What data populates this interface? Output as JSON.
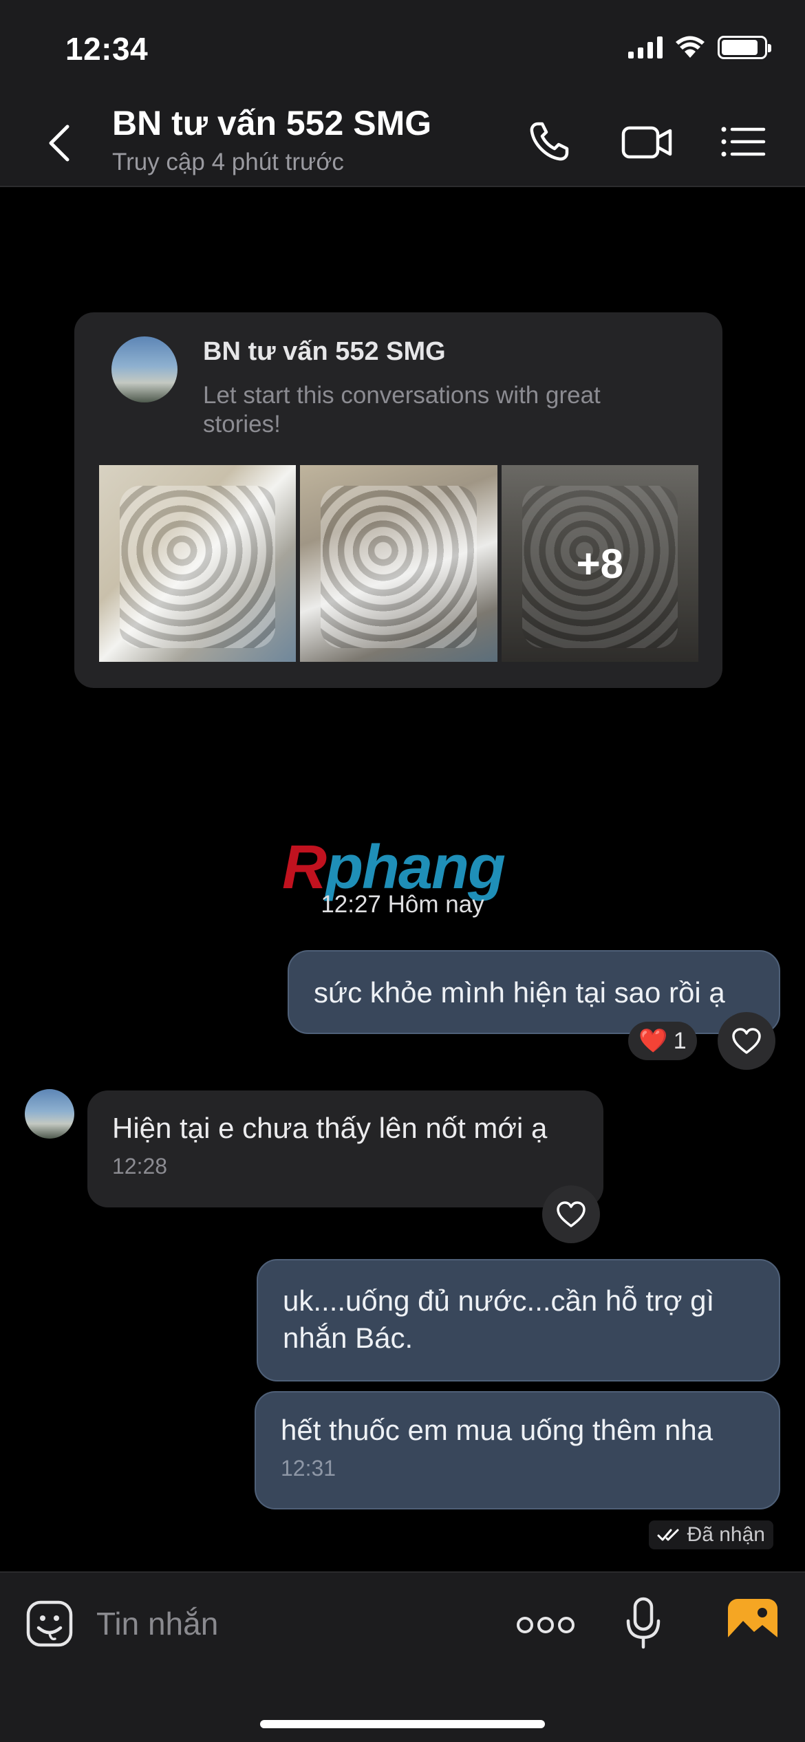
{
  "status_bar": {
    "time": "12:34"
  },
  "header": {
    "title": "BN tư vấn 552 SMG",
    "subtitle": "Truy cập 4 phút trước"
  },
  "intro_card": {
    "name": "BN tư vấn 552 SMG",
    "text": "Let start this conversations with great stories!",
    "more_photos": "+8"
  },
  "watermark": {
    "first": "R",
    "rest": "phang"
  },
  "day_separator": "12:27 Hôm nay",
  "messages": [
    {
      "direction": "out",
      "text": "sức khỏe mình hiện tại sao rồi ạ",
      "reaction_emoji": "❤️",
      "reaction_count": "1"
    },
    {
      "direction": "in",
      "text": "Hiện tại e chưa thấy lên nốt mới ạ",
      "time": "12:28"
    },
    {
      "direction": "out",
      "text": "uk....uống đủ nước...cần hỗ trợ gì nhắn Bác."
    },
    {
      "direction": "out",
      "text": "hết thuốc em mua uống thêm nha",
      "time": "12:31"
    }
  ],
  "delivery_status": "Đã nhận",
  "composer": {
    "placeholder": "Tin nhắn"
  },
  "colors": {
    "outgoing_bubble": "#39475b",
    "incoming_bubble": "#242426",
    "accent_photo": "#f5a623"
  }
}
